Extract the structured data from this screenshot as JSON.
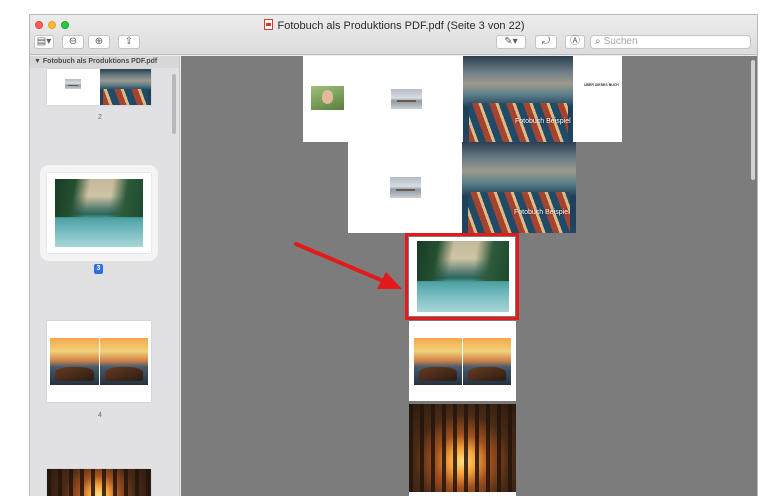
{
  "window": {
    "title": "Fotobuch als Produktions PDF.pdf (Seite 3 von 22)"
  },
  "toolbar": {
    "sidebar_button": "sidebar-view",
    "zoom_out": "zoom-out",
    "zoom_in": "zoom-in",
    "share": "share",
    "markup": "markup-pen",
    "rotate": "rotate",
    "annotate": "annotate",
    "search_placeholder": "Suchen"
  },
  "sidebar": {
    "document_name": "Fotobuch als Produktions PDF.pdf",
    "pages": [
      {
        "label": "2"
      },
      {
        "label": "3",
        "selected": true
      },
      {
        "label": "4"
      }
    ]
  },
  "main": {
    "spread1_caption": "Fotobuch Beispiel",
    "spread1_small_text": "ÜBER DIESES BUCH",
    "spread2_caption": "Fotobuch Beispiel"
  },
  "colors": {
    "highlight": "#e3191b",
    "selection": "#2f6fe4"
  }
}
